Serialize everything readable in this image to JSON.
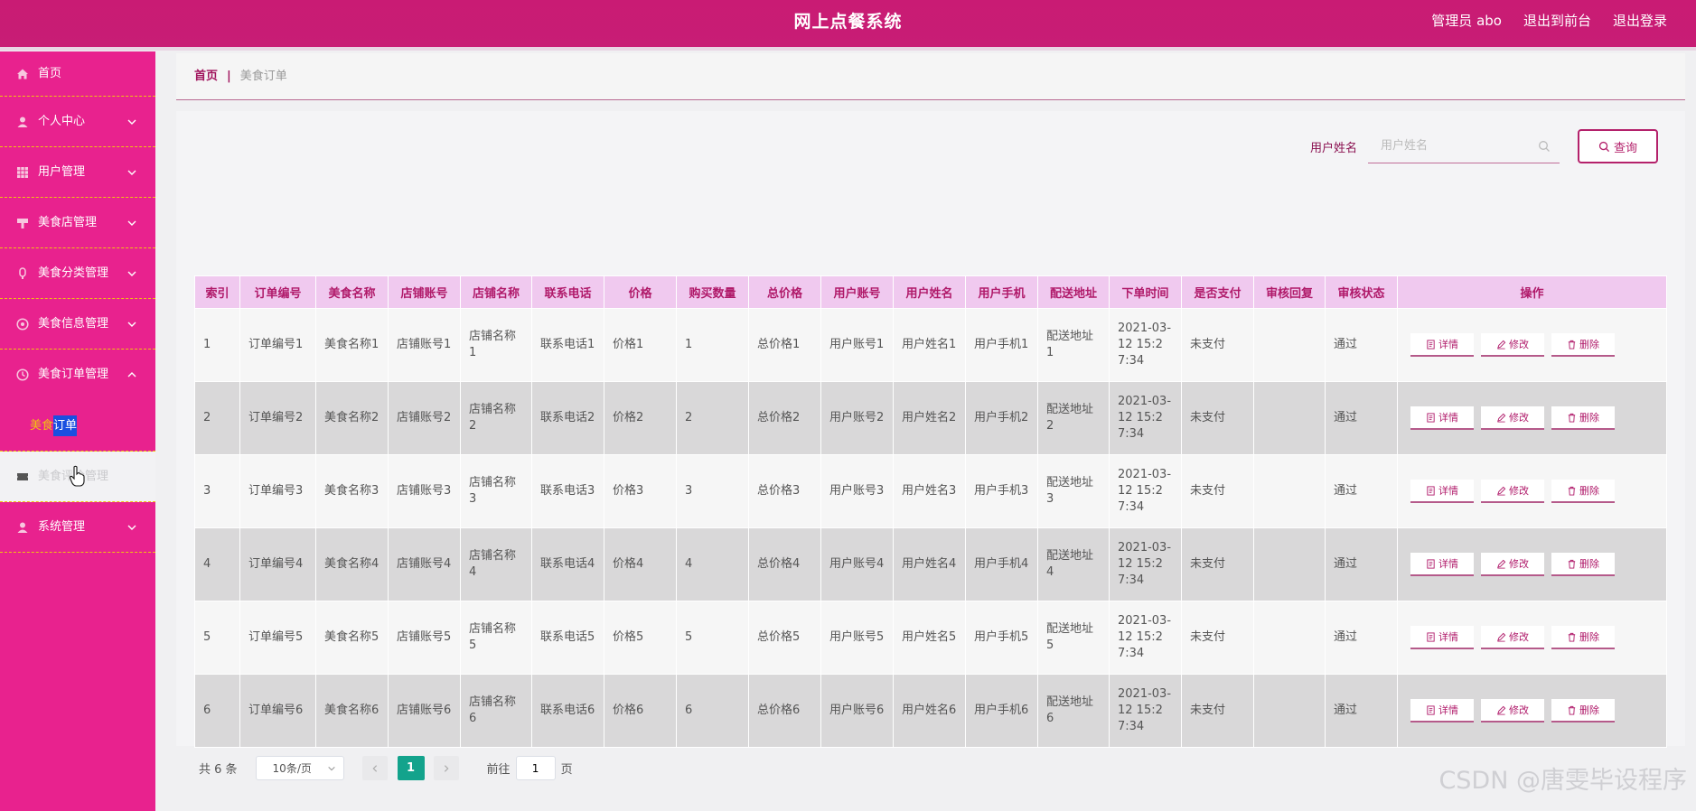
{
  "header": {
    "title": "网上点餐系统",
    "admin": "管理员 abo",
    "to_front": "退出到前台",
    "logout": "退出登录"
  },
  "sidebar": {
    "items": [
      {
        "label": "首页",
        "icon": "home-icon"
      },
      {
        "label": "个人中心",
        "icon": "user-icon"
      },
      {
        "label": "用户管理",
        "icon": "grid-icon"
      },
      {
        "label": "美食店管理",
        "icon": "shop-icon"
      },
      {
        "label": "美食分类管理",
        "icon": "category-icon"
      },
      {
        "label": "美食信息管理",
        "icon": "info-icon"
      },
      {
        "label": "美食订单管理",
        "icon": "clock-icon"
      },
      {
        "label": "美食评价管理",
        "icon": "ticket-icon"
      },
      {
        "label": "系统管理",
        "icon": "user-icon"
      }
    ],
    "sub_item_part1": "美食",
    "sub_item_part2": "订单"
  },
  "breadcrumb": {
    "home": "首页",
    "sep": "|",
    "current": "美食订单"
  },
  "search": {
    "label": "用户姓名",
    "placeholder": "用户姓名",
    "value": "",
    "button": "查询"
  },
  "table": {
    "headers": [
      "索引",
      "订单编号",
      "美食名称",
      "店铺账号",
      "店铺名称",
      "联系电话",
      "价格",
      "购买数量",
      "总价格",
      "用户账号",
      "用户姓名",
      "用户手机",
      "配送地址",
      "下单时间",
      "是否支付",
      "审核回复",
      "审核状态",
      "操作"
    ],
    "rows": [
      [
        "1",
        "订单编号1",
        "美食名称1",
        "店铺账号1",
        "店铺名称1",
        "联系电话1",
        "价格1",
        "1",
        "总价格1",
        "用户账号1",
        "用户姓名1",
        "用户手机1",
        "配送地址1",
        "2021-03-12 15:27:34",
        "未支付",
        "",
        "通过"
      ],
      [
        "2",
        "订单编号2",
        "美食名称2",
        "店铺账号2",
        "店铺名称2",
        "联系电话2",
        "价格2",
        "2",
        "总价格2",
        "用户账号2",
        "用户姓名2",
        "用户手机2",
        "配送地址2",
        "2021-03-12 15:27:34",
        "未支付",
        "",
        "通过"
      ],
      [
        "3",
        "订单编号3",
        "美食名称3",
        "店铺账号3",
        "店铺名称3",
        "联系电话3",
        "价格3",
        "3",
        "总价格3",
        "用户账号3",
        "用户姓名3",
        "用户手机3",
        "配送地址3",
        "2021-03-12 15:27:34",
        "未支付",
        "",
        "通过"
      ],
      [
        "4",
        "订单编号4",
        "美食名称4",
        "店铺账号4",
        "店铺名称4",
        "联系电话4",
        "价格4",
        "4",
        "总价格4",
        "用户账号4",
        "用户姓名4",
        "用户手机4",
        "配送地址4",
        "2021-03-12 15:27:34",
        "未支付",
        "",
        "通过"
      ],
      [
        "5",
        "订单编号5",
        "美食名称5",
        "店铺账号5",
        "店铺名称5",
        "联系电话5",
        "价格5",
        "5",
        "总价格5",
        "用户账号5",
        "用户姓名5",
        "用户手机5",
        "配送地址5",
        "2021-03-12 15:27:34",
        "未支付",
        "",
        "通过"
      ],
      [
        "6",
        "订单编号6",
        "美食名称6",
        "店铺账号6",
        "店铺名称6",
        "联系电话6",
        "价格6",
        "6",
        "总价格6",
        "用户账号6",
        "用户姓名6",
        "用户手机6",
        "配送地址6",
        "2021-03-12 15:27:34",
        "未支付",
        "",
        "通过"
      ]
    ],
    "actions": {
      "detail": "详情",
      "edit": "修改",
      "delete": "删除"
    }
  },
  "pager": {
    "total": "共 6 条",
    "page_size": "10条/页",
    "current_page": "1",
    "goto_prefix": "前往",
    "goto_value": "1",
    "goto_suffix": "页"
  },
  "watermark": "CSDN @唐雯毕设程序",
  "colors": {
    "header": "#c81d75",
    "sidebar": "#e8228e",
    "accent": "#b01a6a",
    "table_header": "#f0c9ef",
    "pager_active": "#13a38c"
  }
}
